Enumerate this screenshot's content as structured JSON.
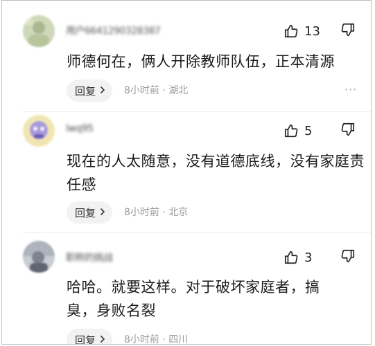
{
  "comments": [
    {
      "username": "用户6641290328387",
      "likes": "13",
      "text": "师德何在，俩人开除教师队伍，正本清源",
      "reply_label": "回复",
      "meta": "8小时前 · 湖北",
      "more": "···"
    },
    {
      "username": "lwq95",
      "likes": "5",
      "text": "现在的人太随意，没有道德底线，没有家庭责任感",
      "reply_label": "回复",
      "meta": "8小时前 · 北京",
      "more": "···"
    },
    {
      "username": "职称的挑战",
      "likes": "3",
      "text": "哈哈。就要这样。对于破坏家庭者，搞臭，身败名裂",
      "reply_label": "回复",
      "meta": "8小时前 · 四川",
      "more": "···"
    }
  ],
  "icons": {
    "like": "thumbs-up-icon",
    "dislike": "thumbs-down-icon",
    "reply_chevron": "chevron-right-icon",
    "more": "more-dots-icon"
  },
  "colors": {
    "text": "#1b1b1b",
    "meta": "#9a9a9a",
    "reply_bg": "#f2f2f2"
  }
}
